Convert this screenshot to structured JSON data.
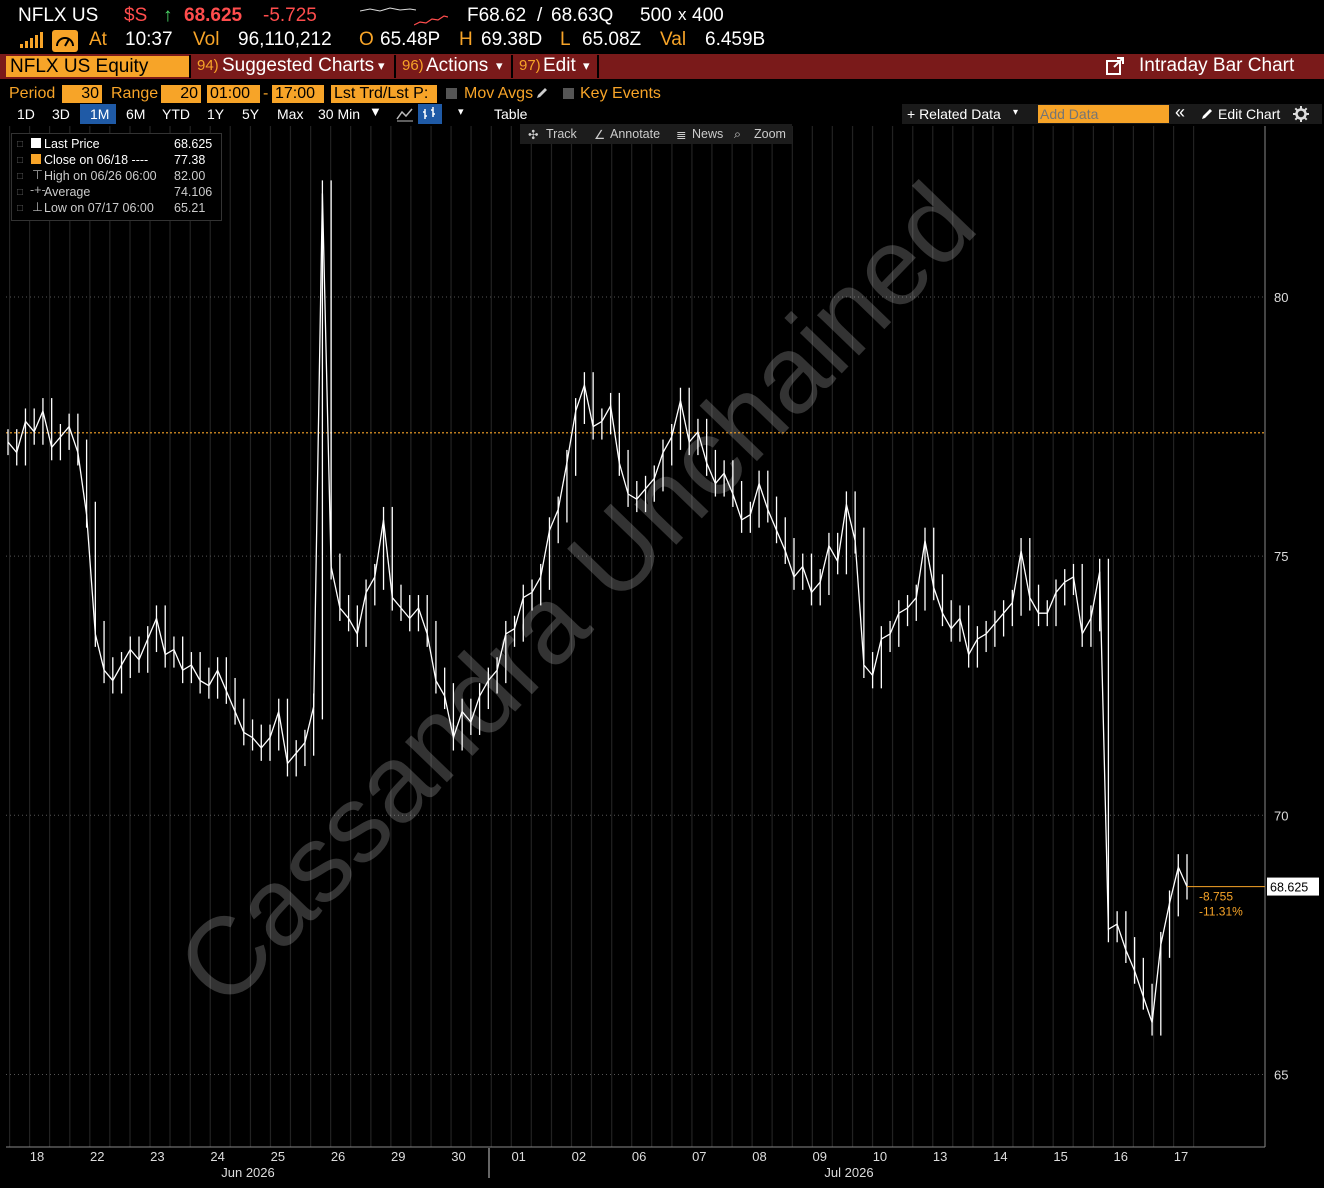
{
  "header": {
    "ticker": "NFLX US",
    "currency": "$S",
    "up_arrow": "↑",
    "last": "68.625",
    "change": "-5.725",
    "forward": "F68.62",
    "slash": "/",
    "ask": "68.63Q",
    "size_a": "500",
    "size_x": "x",
    "size_b": "400",
    "at_label": "At",
    "time": "10:37",
    "vol_label": "Vol",
    "volume": "96,110,212",
    "o_label": "O",
    "open": "65.48P",
    "h_label": "H",
    "high": "69.38D",
    "l_label": "L",
    "low": "65.08Z",
    "val_label": "Val",
    "value": "6.459B"
  },
  "menu": {
    "equity": "NFLX US Equity",
    "suggested_num": "94)",
    "suggested": "Suggested Charts",
    "actions_num": "96)",
    "actions": "Actions",
    "edit_num": "97)",
    "edit": "Edit",
    "caret": "▾",
    "intraday": "Intraday Bar Chart"
  },
  "controls": {
    "period_label": "Period",
    "period_value": "30",
    "range_label": "Range",
    "range_value": "20",
    "time_from": "01:00",
    "dash": "-",
    "time_to": "17:00",
    "lst_trd": "Lst Trd/Lst P:",
    "mov_avgs": "Mov Avgs",
    "key_events": "Key Events"
  },
  "buttons": {
    "ranges": [
      "1D",
      "3D",
      "1M",
      "6M",
      "YTD",
      "1Y",
      "5Y",
      "Max"
    ],
    "interval": "30 Min",
    "table": "Table",
    "related": "+ Related Data",
    "add_data_placeholder": "Add Data",
    "collapse": "«",
    "edit_chart": "Edit Chart"
  },
  "tools": {
    "track": "Track",
    "annotate": "Annotate",
    "news": "News",
    "zoom": "Zoom"
  },
  "legend": {
    "items": [
      {
        "label": "Last Price",
        "value": "68.625"
      },
      {
        "label": "Close on 06/18 ----",
        "value": "77.38"
      },
      {
        "label": "High on 06/26 06:00",
        "value": "82.00"
      },
      {
        "label": "Average",
        "value": "74.106"
      },
      {
        "label": "Low on 07/17 06:00",
        "value": "65.21"
      }
    ]
  },
  "watermark": "Cassandra Unchained",
  "chart_data": {
    "type": "line",
    "x_tick_labels": [
      "18",
      "22",
      "23",
      "24",
      "25",
      "26",
      "29",
      "30",
      "01",
      "02",
      "06",
      "07",
      "08",
      "09",
      "10",
      "13",
      "14",
      "15",
      "16",
      "17"
    ],
    "x_month_labels": [
      "Jun 2026",
      "Jul 2026"
    ],
    "y_ticks": [
      65,
      70,
      75,
      80
    ],
    "ylim": [
      63.6,
      83.3
    ],
    "reference_close": 77.38,
    "last_price_label": "68.625",
    "change_abs": "-8.755",
    "change_pct": "-11.31%",
    "series": [
      {
        "values": [
          77.2,
          77.0,
          77.6,
          77.4,
          77.8,
          77.1,
          77.3,
          77.5,
          77.0,
          75.8,
          73.5,
          72.8,
          72.6,
          72.9,
          73.2,
          73.0,
          73.4,
          73.8,
          73.1,
          73.2,
          72.8,
          72.9,
          72.6,
          72.5,
          72.8,
          72.4,
          72.0,
          71.6,
          71.5,
          71.3,
          71.5,
          72.0,
          71.0,
          71.2,
          71.4,
          72.1,
          82.0,
          74.8,
          74.0,
          73.8,
          73.5,
          74.3,
          74.6,
          75.7,
          74.2,
          74.0,
          73.8,
          74.0,
          73.5,
          72.6,
          72.3,
          71.5,
          72.0,
          71.8,
          72.3,
          72.6,
          72.8,
          73.5,
          73.6,
          74.2,
          74.3,
          74.6,
          75.5,
          75.9,
          76.8,
          77.8,
          78.3,
          77.5,
          77.6,
          77.9,
          76.8,
          76.2,
          76.1,
          76.3,
          76.5,
          77.0,
          77.3,
          78.0,
          77.2,
          77.4,
          76.8,
          76.4,
          76.6,
          76.2,
          75.7,
          75.8,
          76.4,
          75.9,
          75.5,
          75.1,
          74.6,
          74.8,
          74.3,
          74.5,
          75.2,
          74.9,
          76.0,
          75.3,
          72.9,
          72.7,
          73.4,
          73.5,
          73.9,
          74.0,
          74.2,
          75.3,
          74.4,
          73.9,
          73.6,
          73.8,
          73.1,
          73.4,
          73.5,
          73.7,
          73.9,
          74.1,
          75.1,
          74.2,
          73.9,
          73.9,
          74.3,
          74.5,
          74.6,
          73.5,
          73.8,
          74.7,
          67.8,
          67.9,
          67.4,
          67.0,
          66.5,
          66.0,
          67.5,
          68.3,
          69.0,
          68.625
        ]
      }
    ]
  }
}
